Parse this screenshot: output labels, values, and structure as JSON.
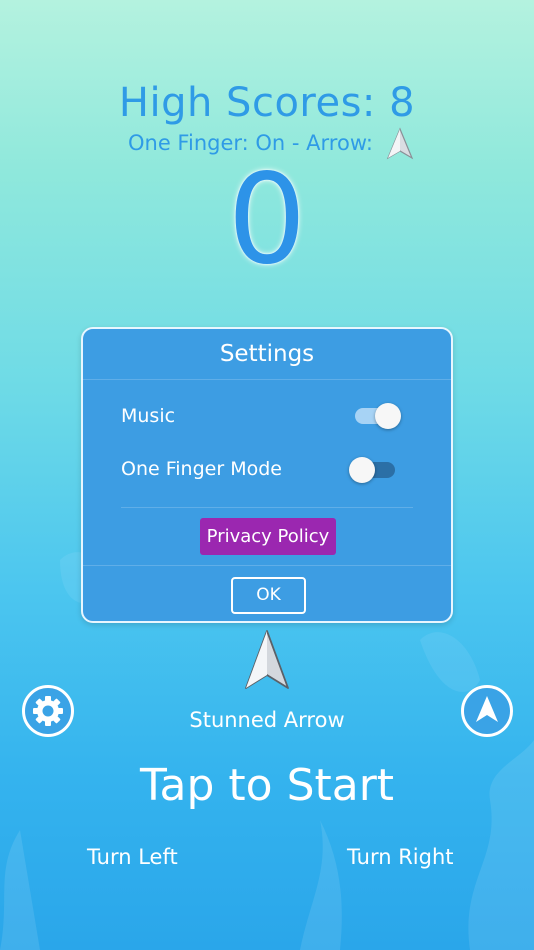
{
  "header": {
    "high_scores": "High Scores: 8",
    "mode_line": "One Finger: On - Arrow:",
    "arrow_icon": "arrow-icon"
  },
  "score": "0",
  "settings_dialog": {
    "title": "Settings",
    "rows": [
      {
        "label": "Music",
        "enabled": true
      },
      {
        "label": "One Finger Mode",
        "enabled": false
      }
    ],
    "privacy_label": "Privacy Policy",
    "ok_label": "OK"
  },
  "arrow_select": {
    "name": "Stunned Arrow",
    "icon": "arrow-icon"
  },
  "buttons": {
    "settings_icon": "gear-icon",
    "arrow_icon": "arrow-circle-icon"
  },
  "start_text": "Tap to Start",
  "controls": {
    "left": "Turn Left",
    "right": "Turn Right"
  },
  "colors": {
    "accent": "#2f9be6",
    "dialog": "#3d9de3",
    "privacy": "#9b27b0"
  }
}
